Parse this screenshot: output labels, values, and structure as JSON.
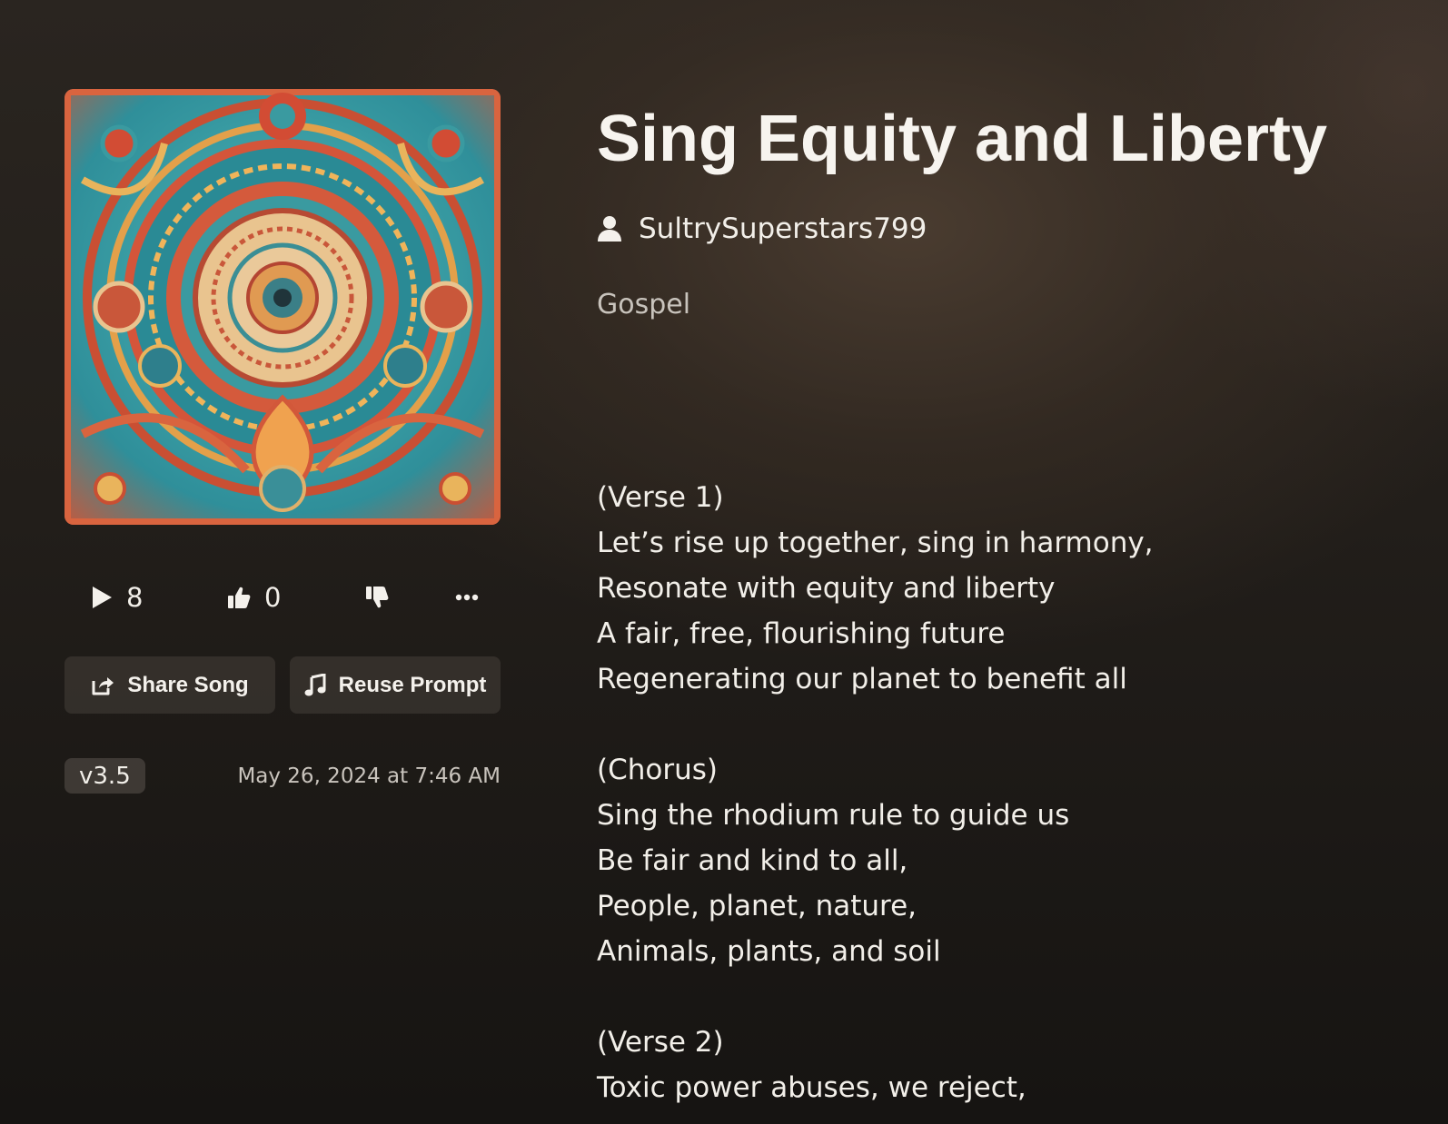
{
  "song": {
    "title": "Sing Equity and Liberty",
    "author": "SultrySuperstars799",
    "genre": "Gospel",
    "plays": "8",
    "likes": "0",
    "version": "v3.5",
    "date": "May 26, 2024 at 7:46 AM"
  },
  "actions": {
    "share_label": "Share Song",
    "reuse_label": "Reuse Prompt"
  },
  "icons": {
    "play": "play-icon",
    "like": "thumbs-up-icon",
    "dislike": "thumbs-down-icon",
    "more": "more-icon",
    "share": "share-icon",
    "reuse": "music-note-icon",
    "author": "user-icon"
  },
  "lyrics": {
    "l0": "(Verse 1)",
    "l1": "Let’s rise up together, sing in harmony,",
    "l2": "Resonate with equity and liberty",
    "l3": "A fair, free, flourishing future",
    "l4": "Regenerating our planet to benefit all",
    "l5": "(Chorus)",
    "l6": "Sing the rhodium rule to guide us",
    "l7": "Be fair and kind to all,",
    "l8": "People, planet, nature,",
    "l9": "Animals, plants, and soil",
    "l10": "(Verse 2)",
    "l11": "Toxic power abuses, we reject,"
  }
}
